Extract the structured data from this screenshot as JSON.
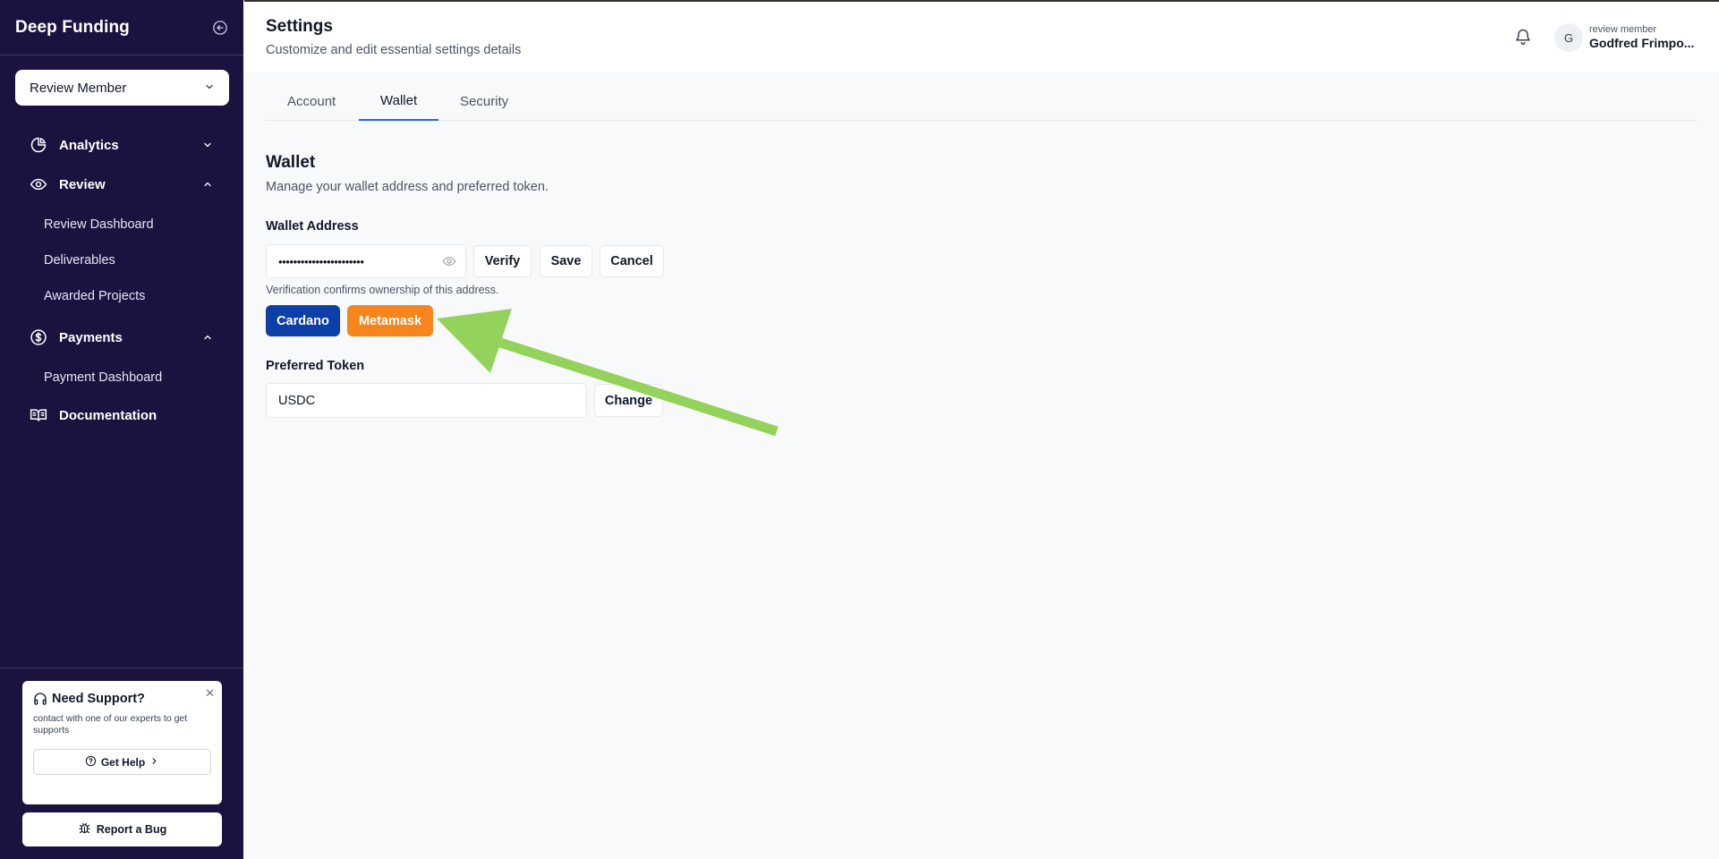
{
  "sidebar": {
    "brand": "Deep Funding",
    "role_select": "Review Member",
    "nav": {
      "analytics": "Analytics",
      "review": "Review",
      "review_items": [
        "Review Dashboard",
        "Deliverables",
        "Awarded Projects"
      ],
      "payments": "Payments",
      "payments_items": [
        "Payment Dashboard"
      ],
      "documentation": "Documentation"
    },
    "support": {
      "title": "Need Support?",
      "description": "contact with one of our experts to get supports",
      "get_help": "Get Help"
    },
    "report_bug": "Report a Bug"
  },
  "header": {
    "title": "Settings",
    "subtitle": "Customize and edit essential settings details",
    "user": {
      "initial": "G",
      "role": "review member",
      "name": "Godfred Frimpo..."
    }
  },
  "tabs": [
    "Account",
    "Wallet",
    "Security"
  ],
  "active_tab": "Wallet",
  "wallet": {
    "title": "Wallet",
    "description": "Manage your wallet address and preferred token.",
    "address_label": "Wallet Address",
    "address_masked": "•••••••••••••••••••••••",
    "verify_label": "Verify",
    "save_label": "Save",
    "cancel_label": "Cancel",
    "hint": "Verification confirms ownership of this address.",
    "providers": [
      "Cardano",
      "Metamask"
    ],
    "token_label": "Preferred Token",
    "token_value": "USDC",
    "change_label": "Change"
  },
  "colors": {
    "sidebar_bg": "#1c1240",
    "cardano": "#0c3fa7",
    "metamask": "#f6851b",
    "tab_active": "#2563eb",
    "annotation_arrow": "#93d35c"
  }
}
